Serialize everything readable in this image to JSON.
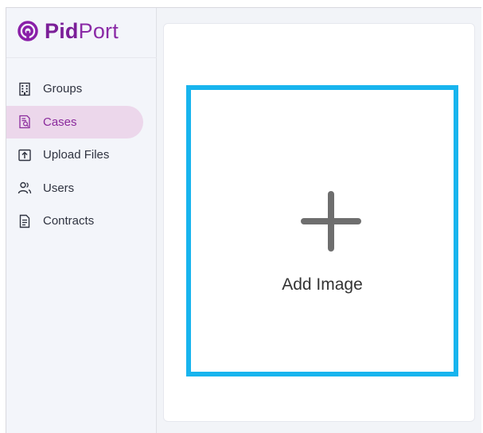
{
  "brand": {
    "name_part1": "Pid",
    "name_part2": "Port"
  },
  "sidebar": {
    "items": [
      {
        "label": "Groups",
        "icon": "building-icon",
        "active": false
      },
      {
        "label": "Cases",
        "icon": "case-search-icon",
        "active": true
      },
      {
        "label": "Upload Files",
        "icon": "upload-icon",
        "active": false
      },
      {
        "label": "Users",
        "icon": "users-icon",
        "active": false
      },
      {
        "label": "Contracts",
        "icon": "document-icon",
        "active": false
      }
    ]
  },
  "main": {
    "upload": {
      "label": "Add Image"
    }
  },
  "colors": {
    "accent": "#18b4ee",
    "brand": "#7b1f98",
    "active_nav_bg": "#ecd7eb"
  }
}
